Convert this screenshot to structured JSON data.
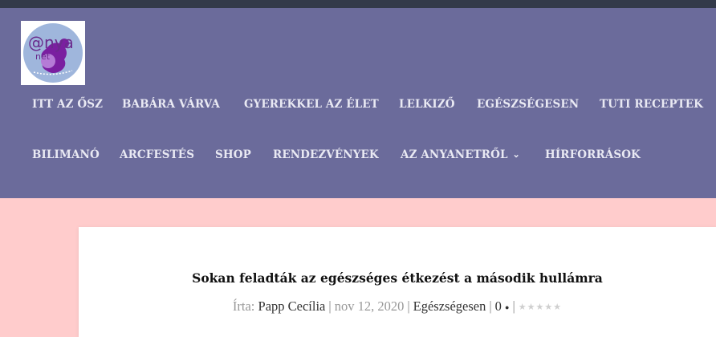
{
  "site": {
    "logo_text_1": "@nya",
    "logo_text_2": "net"
  },
  "nav": {
    "row1": [
      "ITT AZ ŐSZ",
      "BABÁRA VÁRVA",
      "GYEREKKEL AZ ÉLET",
      "LELKIZŐ",
      "EGÉSZSÉGESEN",
      "TUTI RECEPTEK"
    ],
    "row2": [
      "BILIMANÓ",
      "ARCFESTÉS",
      "SHOP",
      "RENDEZVÉNYEK",
      "AZ ANYANETRŐL",
      "HÍRFORRÁSOK"
    ]
  },
  "post": {
    "title": "Sokan feladták az egészséges étkezést a második hullámra",
    "by_label": "Írta:",
    "author": "Papp Cecília",
    "date": "nov 12, 2020",
    "category": "Egészségesen",
    "comments": "0",
    "rating_stars": 0
  },
  "colors": {
    "header": "#6b6b9b",
    "page_bg": "#ffcccc",
    "topbar": "#333a4a"
  }
}
